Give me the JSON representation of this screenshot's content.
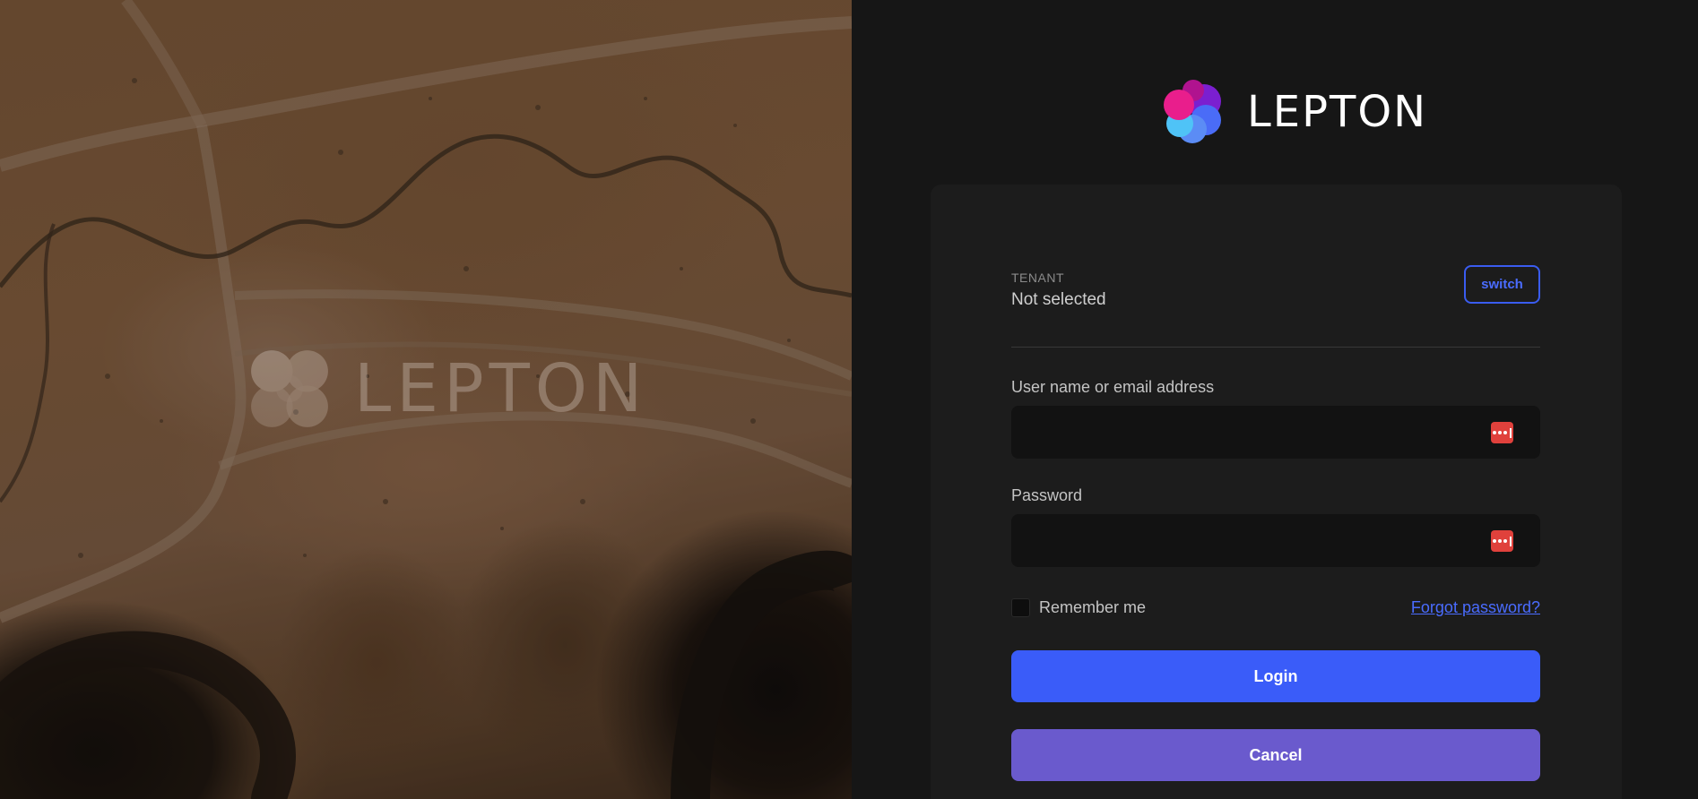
{
  "hero": {
    "watermark_text": "LEPTON"
  },
  "brand": {
    "name": "LEPTON"
  },
  "tenant": {
    "label": "TENANT",
    "value": "Not selected",
    "switch_label": "switch"
  },
  "login_form": {
    "username_label": "User name or email address",
    "username_value": "",
    "password_label": "Password",
    "password_value": "",
    "remember_label": "Remember me",
    "remember_checked": false,
    "forgot_label": "Forgot password?",
    "login_label": "Login",
    "cancel_label": "Cancel"
  },
  "icons": {
    "brand_logo": "lepton-logo-icon",
    "password_manager": "password-manager-icon"
  },
  "colors": {
    "background": "#161616",
    "card": "#1c1c1c",
    "input": "#121212",
    "accent": "#3a5cf9",
    "cancel": "#6a5acd",
    "link": "#4a6cff",
    "password_manager": "#e0413c",
    "logo_pink": "#e91e8c",
    "logo_purple": "#7b1fd0",
    "logo_blue": "#4a6cf7",
    "logo_cyan": "#4fc3f7"
  }
}
